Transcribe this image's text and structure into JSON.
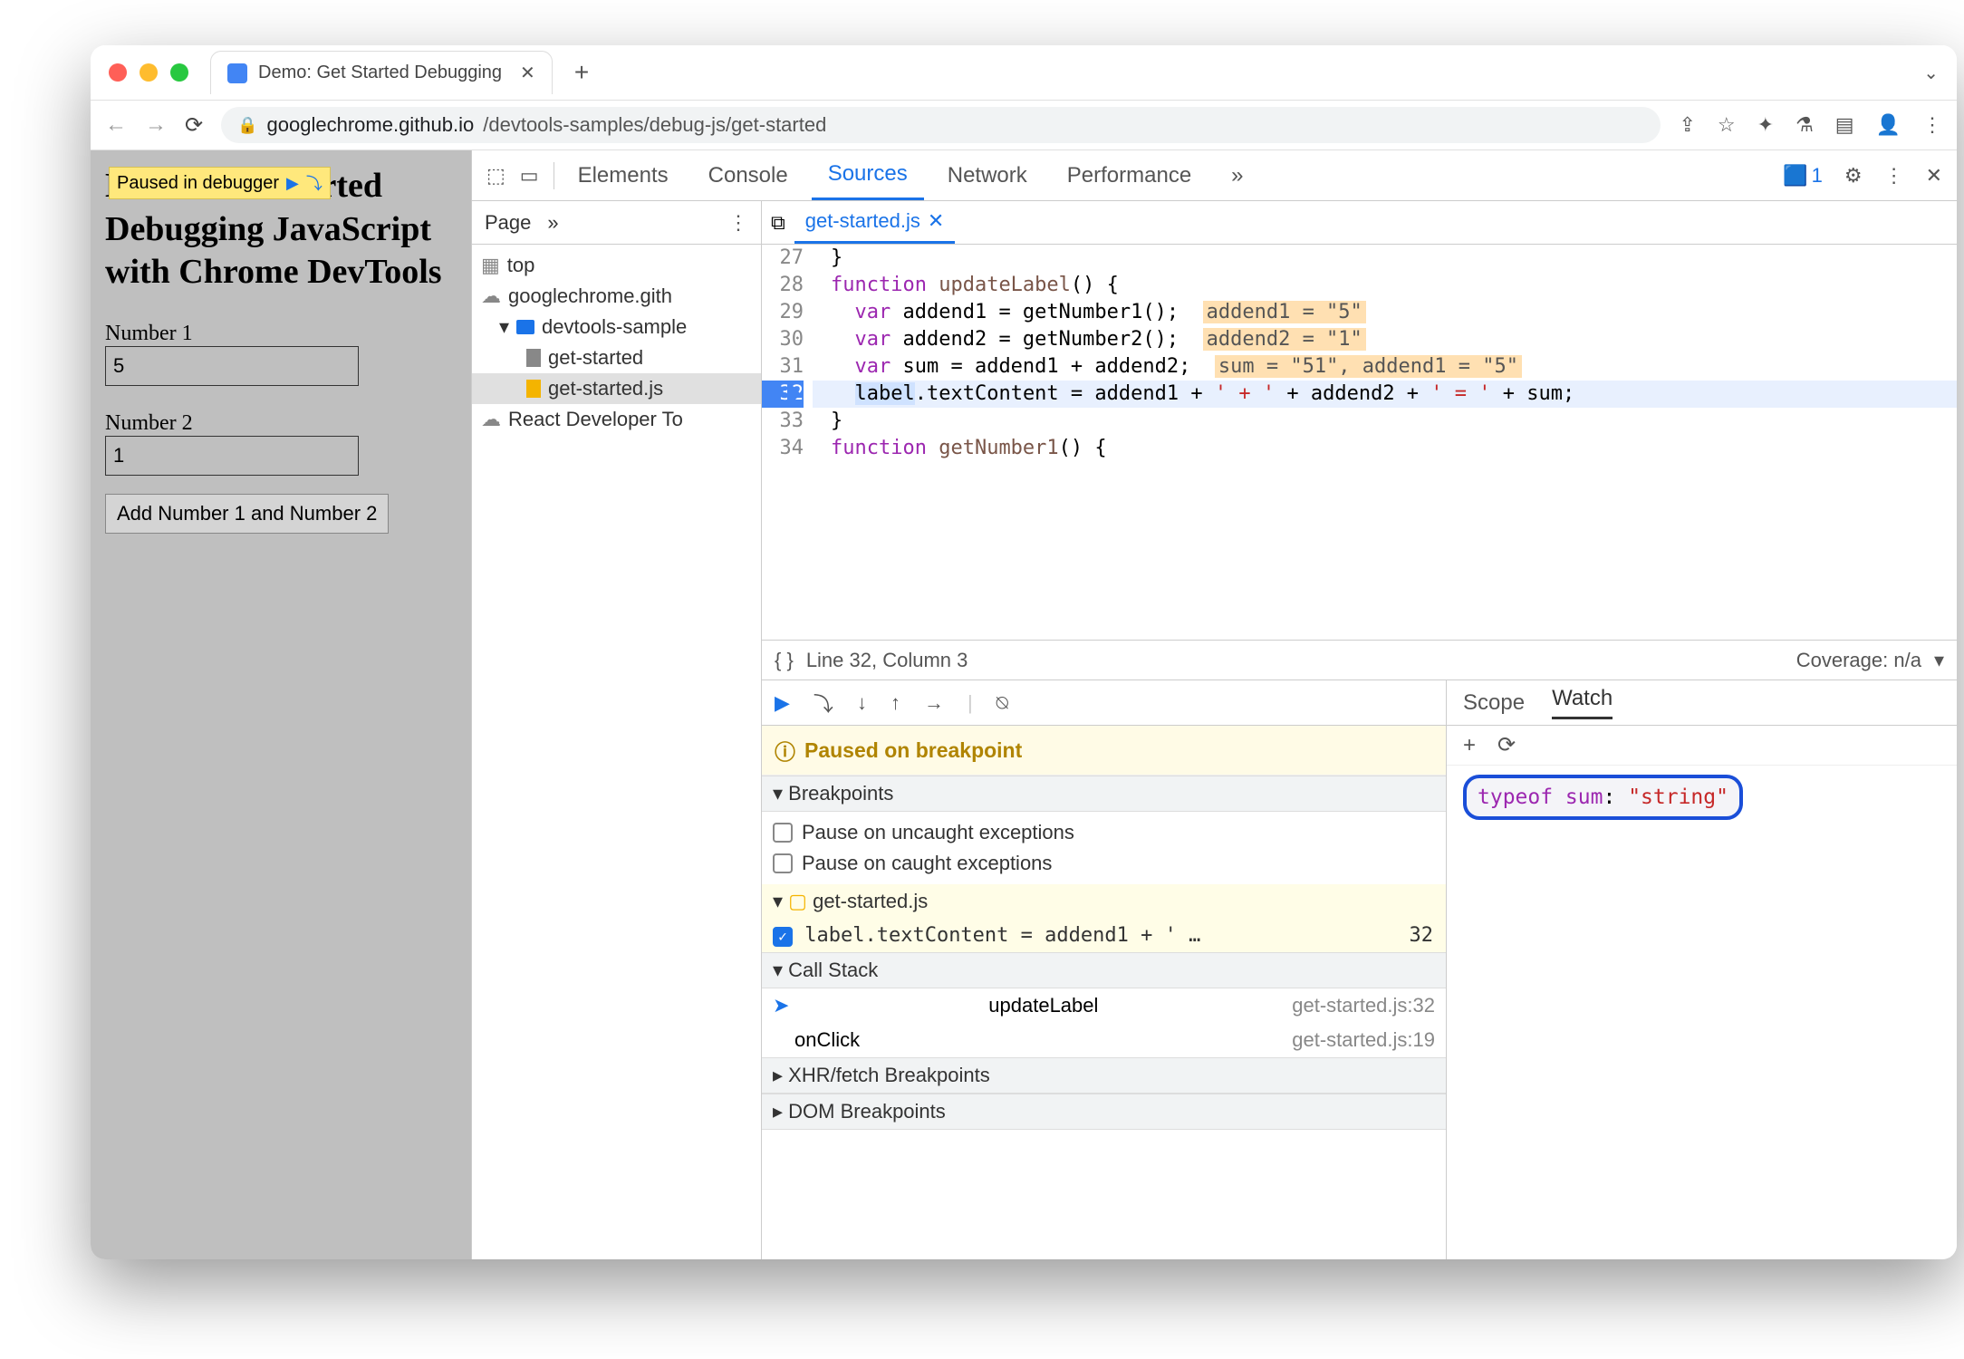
{
  "browser": {
    "tab_title": "Demo: Get Started Debugging",
    "url_host": "googlechrome.github.io",
    "url_path": "/devtools-samples/debug-js/get-started"
  },
  "overlay": {
    "text": "Paused in debugger"
  },
  "page": {
    "heading_1": "Demo: Get Started",
    "heading_2": "Debugging JavaScript with Chrome DevTools",
    "label_num1": "Number 1",
    "value_num1": "5",
    "label_num2": "Number 2",
    "value_num2": "1",
    "button": "Add Number 1 and Number 2"
  },
  "devtools": {
    "tabs": {
      "elements": "Elements",
      "console": "Console",
      "sources": "Sources",
      "network": "Network",
      "performance": "Performance"
    },
    "issues_count": "1",
    "sources": {
      "tab": "Page",
      "tree": {
        "top": "top",
        "domain": "googlechrome.gith",
        "folder": "devtools-sample",
        "file_html": "get-started",
        "file_js": "get-started.js",
        "ext": "React Developer To"
      },
      "open_file": "get-started.js",
      "status_line": "Line 32, Column 3",
      "coverage": "Coverage: n/a"
    },
    "code": {
      "l27": "}",
      "l28a": "function",
      "l28b": " updateLabel",
      "l28c": "() {",
      "l29a": "  var",
      "l29b": " addend1 = getNumber1();  ",
      "l29h": "addend1 = \"5\"",
      "l30a": "  var",
      "l30b": " addend2 = getNumber2();  ",
      "l30h": "addend2 = \"1\"",
      "l31a": "  var",
      "l31b": " sum = addend1 + addend2;  ",
      "l31h": "sum = \"51\", addend1 = \"5\"",
      "l32a": "  ",
      "l32sel": "label",
      "l32b": ".textContent = addend1 + ",
      "l32s1": "' + '",
      "l32c": " + addend2 + ",
      "l32s2": "' = '",
      "l32d": " + sum;",
      "l33": "}",
      "l34a": "function",
      "l34b": " getNumber1",
      "l34c": "() {",
      "lines": {
        "n27": "27",
        "n28": "28",
        "n29": "29",
        "n30": "30",
        "n31": "31",
        "n32": "32",
        "n33": "33",
        "n34": "34"
      }
    },
    "debugger": {
      "paused_msg": "Paused on breakpoint",
      "sections": {
        "breakpoints": "Breakpoints",
        "uncaught": "Pause on uncaught exceptions",
        "caught": "Pause on caught exceptions",
        "bp_file": "get-started.js",
        "bp_text": "label.textContent = addend1 + ' …",
        "bp_line": "32",
        "callstack": "Call Stack",
        "cs1_fn": "updateLabel",
        "cs1_loc": "get-started.js:32",
        "cs2_fn": "onClick",
        "cs2_loc": "get-started.js:19",
        "xhr": "XHR/fetch Breakpoints",
        "dom": "DOM Breakpoints"
      },
      "watch": {
        "tab_scope": "Scope",
        "tab_watch": "Watch",
        "expr": "typeof sum",
        "val": "\"string\""
      }
    }
  }
}
